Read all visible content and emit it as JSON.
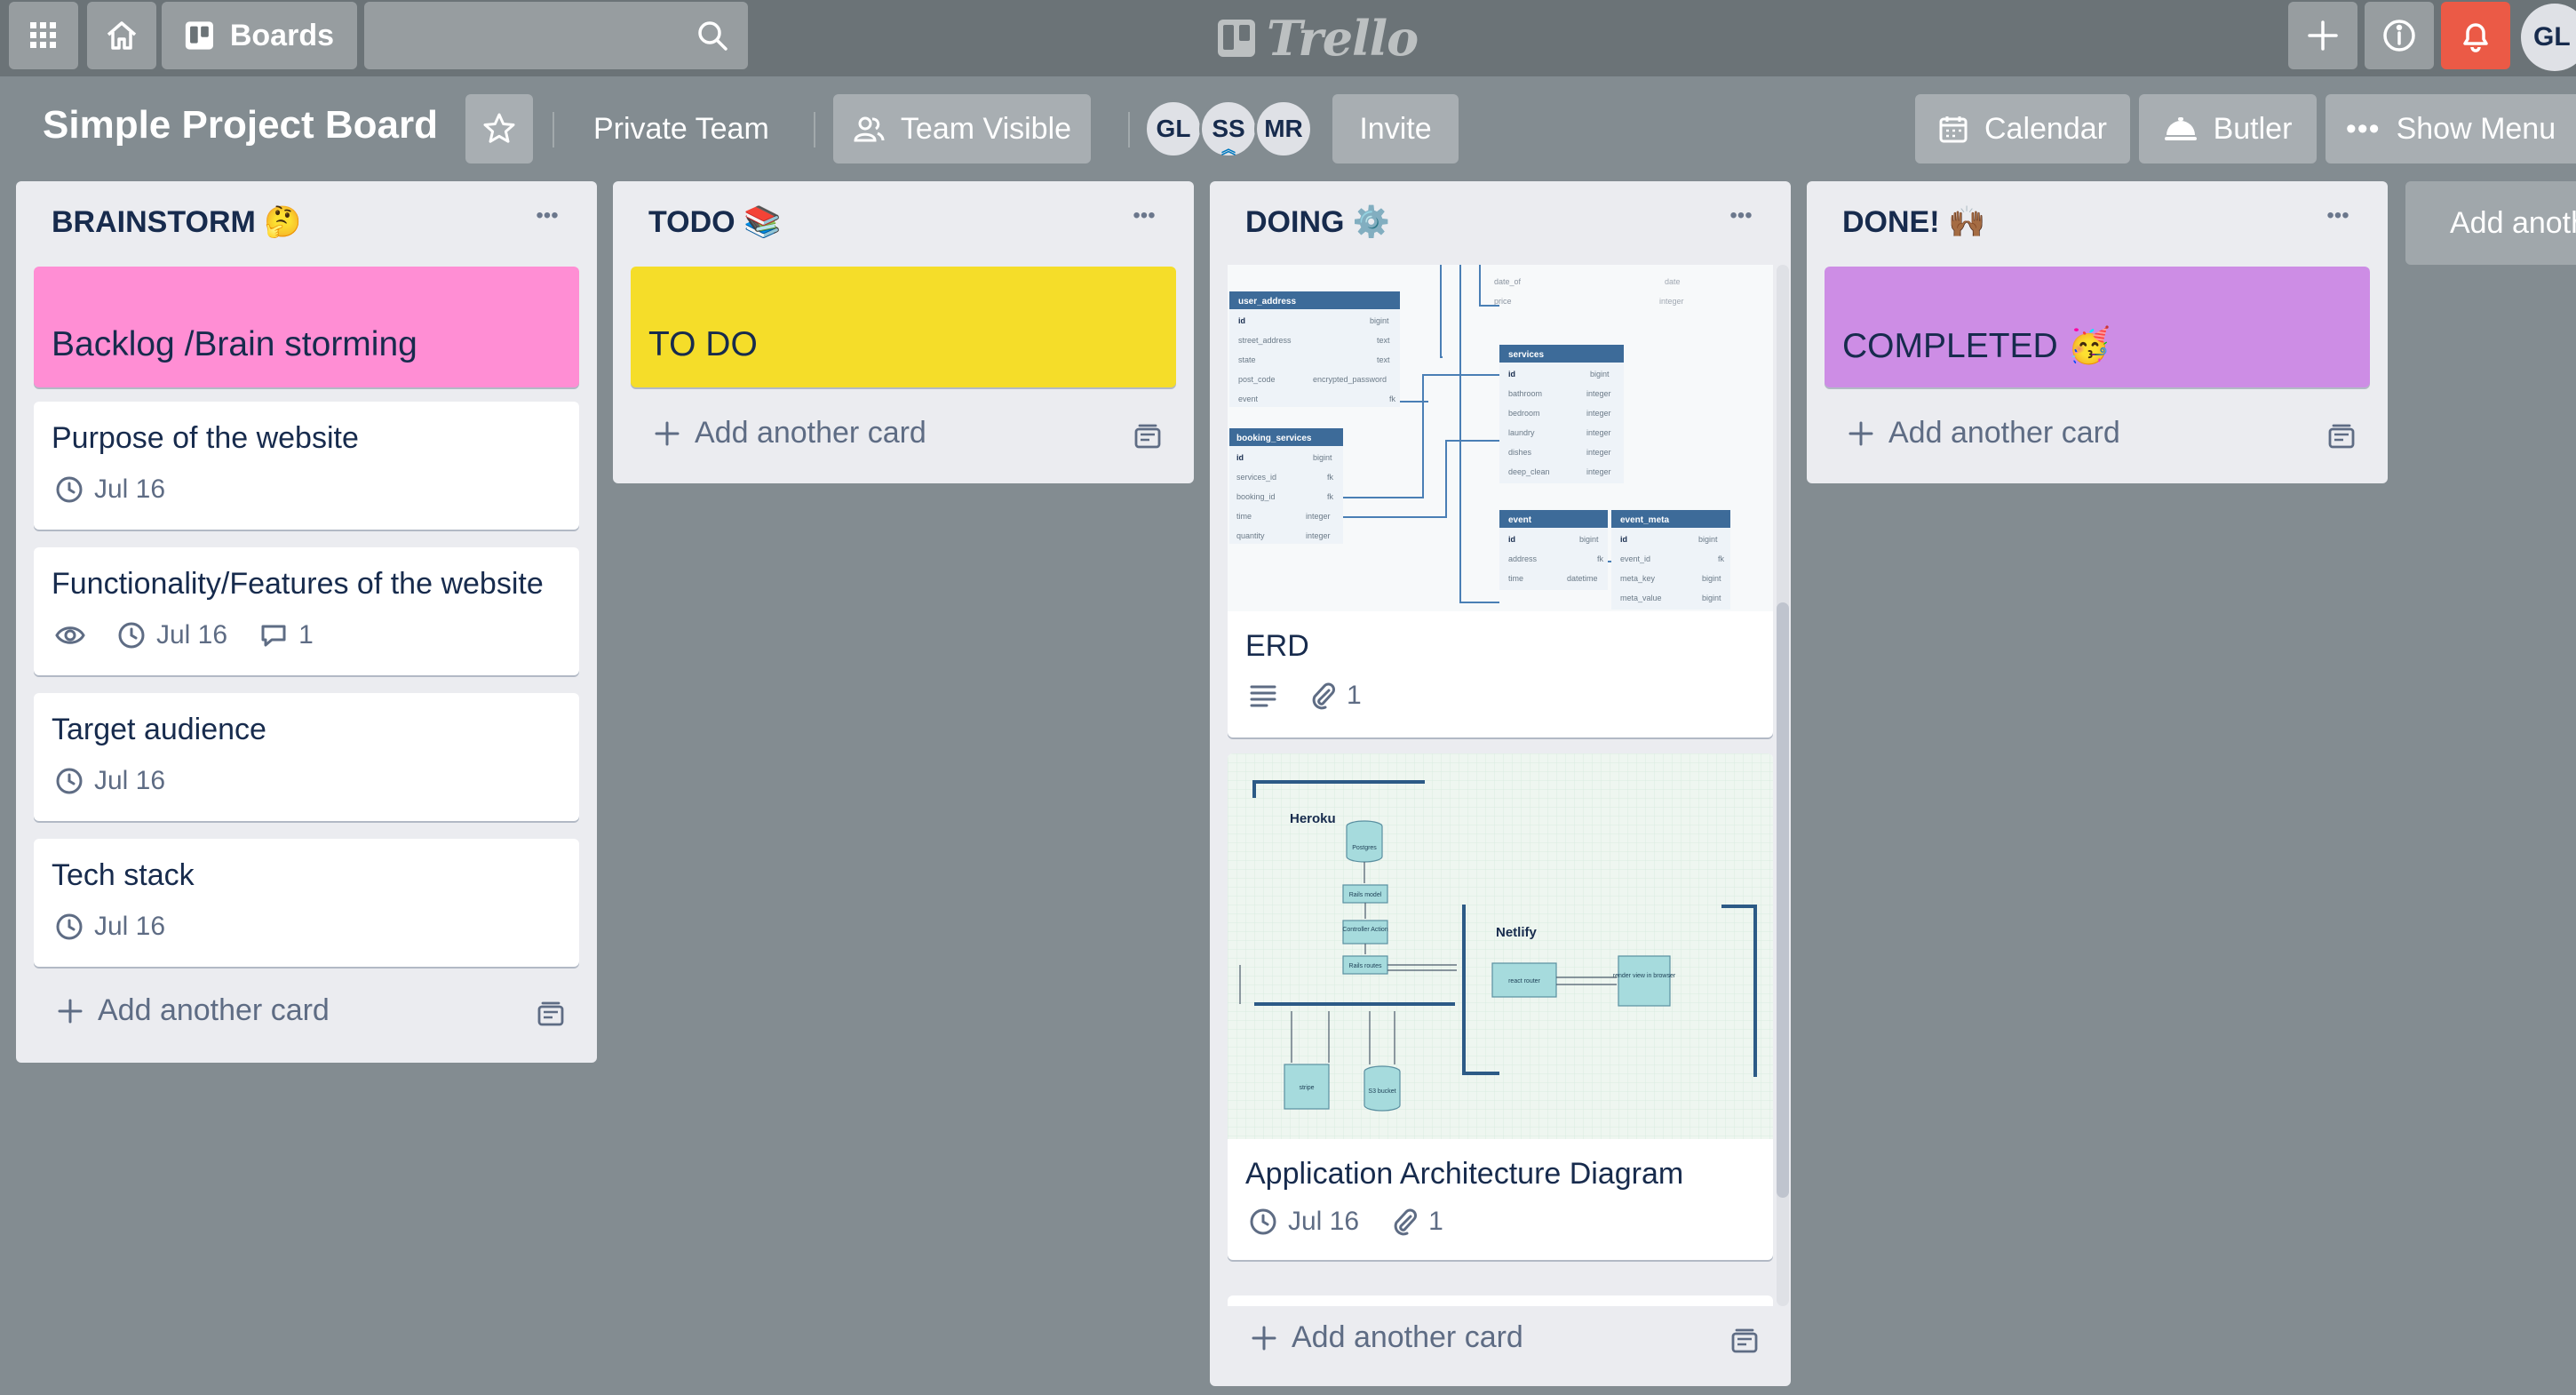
{
  "header": {
    "boards_label": "Boards",
    "search_placeholder": "",
    "logo_text": "Trello",
    "user_initials": "GL"
  },
  "board": {
    "title": "Simple Project Board",
    "team_label": "Private Team",
    "visibility_label": "Team Visible",
    "members": [
      "GL",
      "SS",
      "MR"
    ],
    "invite_label": "Invite",
    "calendar_label": "Calendar",
    "butler_label": "Butler",
    "show_menu_label": "Show Menu"
  },
  "lists": [
    {
      "title": "BRAINSTORM 🤔",
      "cover_title": "Backlog /Brain storming",
      "cover_color": "#ff8ed4",
      "cards": [
        {
          "title": "Purpose of the website",
          "due": "Jul 16"
        },
        {
          "title": "Functionality/Features of the website",
          "due": "Jul 16",
          "comments": "1",
          "watching": true
        },
        {
          "title": "Target audience",
          "due": "Jul 16"
        },
        {
          "title": "Tech stack",
          "due": "Jul 16"
        }
      ],
      "add_card_label": "Add another card"
    },
    {
      "title": "TODO 📚",
      "cover_title": "TO DO",
      "cover_color": "#f5dd29",
      "cards": [],
      "add_card_label": "Add another card"
    },
    {
      "title": "DOING ⚙️",
      "cards": [
        {
          "title": "ERD",
          "attachments": "1",
          "has_description": true
        },
        {
          "title": "Application Architecture Diagram",
          "due": "Jul 16",
          "attachments": "1"
        }
      ],
      "add_card_label": "Add another card"
    },
    {
      "title": "DONE! 🙌🏾",
      "cover_title": "COMPLETED 🥳",
      "cover_color": "#cd8de5",
      "cards": [],
      "add_card_label": "Add another card"
    }
  ],
  "add_list_label": "Add another list",
  "erd": {
    "tables": [
      {
        "name": "user_address",
        "rows": [
          "id",
          "street_address",
          "state",
          "post_code",
          "event"
        ],
        "types": [
          "bigint",
          "text",
          "text",
          "encrypted_password",
          "fk"
        ]
      },
      {
        "name": "booking_services",
        "rows": [
          "id",
          "services_id",
          "booking_id",
          "time",
          "quantity"
        ],
        "types": [
          "bigint",
          "fk",
          "fk",
          "integer",
          "integer"
        ]
      },
      {
        "name": "services",
        "rows": [
          "id",
          "bathroom",
          "bedroom",
          "laundry",
          "dishes",
          "deep_clean"
        ],
        "types": [
          "bigint",
          "integer",
          "integer",
          "integer",
          "integer",
          "integer"
        ]
      },
      {
        "name": "event",
        "rows": [
          "id",
          "address",
          "time"
        ],
        "types": [
          "bigint",
          "fk",
          "datetime"
        ]
      },
      {
        "name": "event_meta",
        "rows": [
          "id",
          "event_id",
          "meta_key",
          "meta_value"
        ],
        "types": [
          "bigint",
          "fk",
          "bigint",
          "bigint"
        ]
      }
    ],
    "partial_rows": [
      "date_of",
      "price"
    ],
    "partial_types": [
      "date",
      "integer"
    ]
  },
  "arch": {
    "heroku": "Heroku",
    "netlify": "Netlify",
    "postgres": "Postgres",
    "rails_model": "Rails model",
    "controller": "Controller Action",
    "rails_routes": "Rails routes",
    "react_router": "react router",
    "render_view": "render view in browser",
    "stripe": "stripe",
    "s3": "S3 bucket"
  },
  "colors": {
    "board_bg": "#838c91",
    "header_bg": "#6b7377",
    "list_bg": "#ebecf0",
    "notification": "#eb5a46",
    "erd_header": "#3d6b99"
  }
}
